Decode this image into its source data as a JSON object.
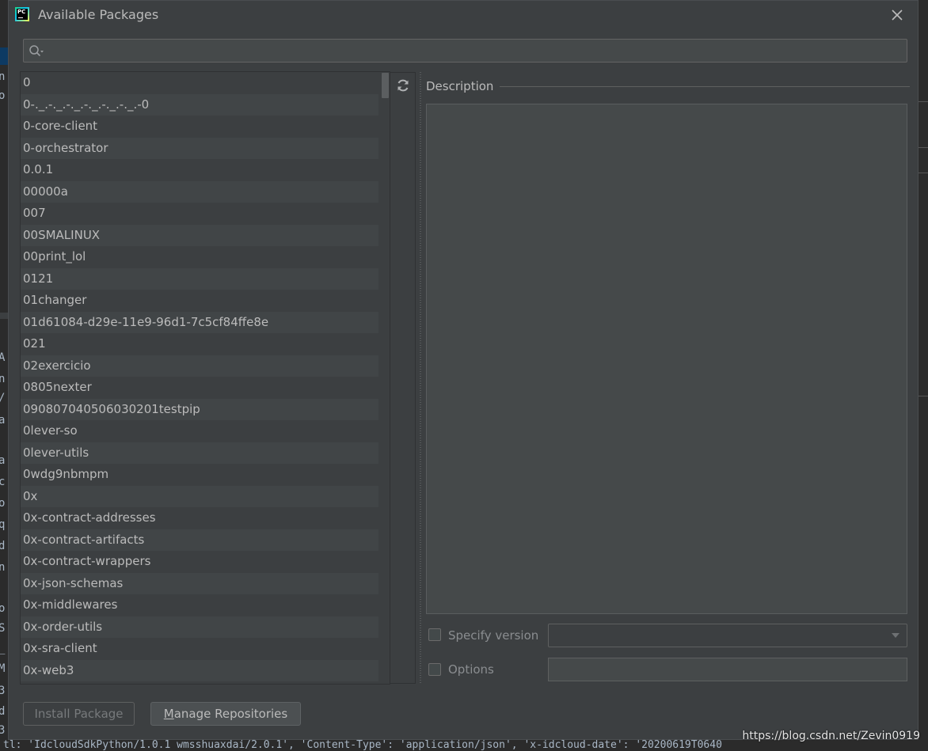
{
  "dialog": {
    "title": "Available Packages",
    "app_icon_text": "PC"
  },
  "search": {
    "value": "",
    "placeholder": ""
  },
  "packages": [
    "0",
    "0-._.-._.-._.-._.-._.-._.-0",
    "0-core-client",
    "0-orchestrator",
    "0.0.1",
    "00000a",
    "007",
    "00SMALINUX",
    "00print_lol",
    "0121",
    "01changer",
    "01d61084-d29e-11e9-96d1-7c5cf84ffe8e",
    "021",
    "02exercicio",
    "0805nexter",
    "090807040506030201testpip",
    "0lever-so",
    "0lever-utils",
    "0wdg9nbmpm",
    "0x",
    "0x-contract-addresses",
    "0x-contract-artifacts",
    "0x-contract-wrappers",
    "0x-json-schemas",
    "0x-middlewares",
    "0x-order-utils",
    "0x-sra-client",
    "0x-web3"
  ],
  "details": {
    "description_label": "Description",
    "specify_version_label": "Specify version",
    "options_label": "Options",
    "version_value": "",
    "options_value": ""
  },
  "buttons": {
    "install": "Install Package",
    "manage": "Manage Repositories"
  },
  "watermark": "https://blog.csdn.net/Zevin0919",
  "background": {
    "bottom_code": "tl: 'IdcloudSdkPython/1.0.1 wmsshuaxdai/2.0.1', 'Content-Type': 'application/json', 'x-idcloud-date': '20200619T0640",
    "left_chars": [
      "n",
      "o",
      "A",
      "n",
      "/",
      "a",
      "a",
      "c",
      "o",
      "q",
      "d",
      "n",
      "o",
      "S",
      "_",
      "M",
      "3",
      "d",
      "3"
    ]
  },
  "colors": {
    "dialog_bg": "#3c3f41",
    "text": "#bbbbbb",
    "disabled_text": "#777a7c"
  }
}
